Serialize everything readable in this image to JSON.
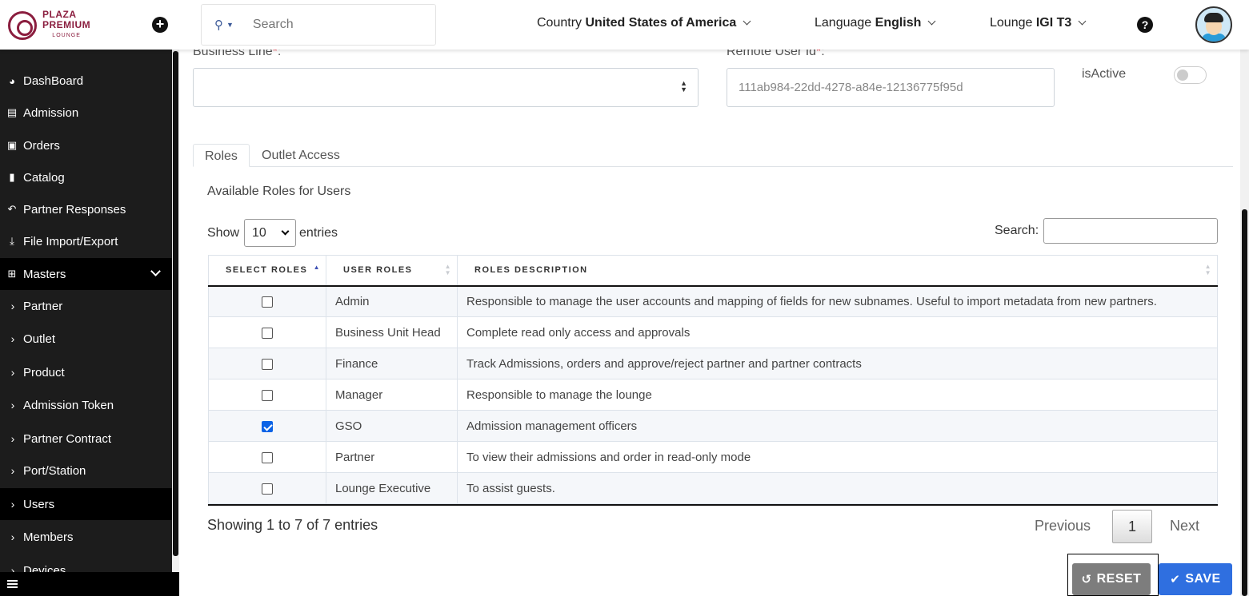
{
  "header": {
    "logo_line1": "PLAZA",
    "logo_line2": "PREMIUM",
    "logo_line3": "LOUNGE",
    "search_placeholder": "Search",
    "country_label": "Country",
    "country_value": "United States of America",
    "language_label": "Language",
    "language_value": "English",
    "lounge_label": "Lounge",
    "lounge_value": "IGI T3",
    "help_glyph": "?"
  },
  "sidebar": {
    "items": [
      {
        "label": "DashBoard",
        "icon": "dashboard-icon",
        "glyph": "◕"
      },
      {
        "label": "Admission",
        "icon": "id-card-icon",
        "glyph": "▤"
      },
      {
        "label": "Orders",
        "icon": "cart-icon",
        "glyph": "🛒"
      },
      {
        "label": "Catalog",
        "icon": "file-icon",
        "glyph": "▮"
      },
      {
        "label": "Partner Responses",
        "icon": "reply-icon",
        "glyph": "↶"
      },
      {
        "label": "File Import/Export",
        "icon": "download-icon",
        "glyph": "⤓"
      },
      {
        "label": "Masters",
        "icon": "sitemap-icon",
        "glyph": "⊞"
      }
    ],
    "sub_items": [
      {
        "label": "Partner"
      },
      {
        "label": "Outlet"
      },
      {
        "label": "Product"
      },
      {
        "label": "Admission Token"
      },
      {
        "label": "Partner Contract"
      },
      {
        "label": "Port/Station"
      },
      {
        "label": "Users",
        "active": true
      },
      {
        "label": "Members"
      },
      {
        "label": "Devices"
      }
    ]
  },
  "form": {
    "business_line_label": "Business Line",
    "required_mark": "*",
    "label_suffix": ":",
    "business_line_value": "",
    "remote_user_id_label": "Remote User Id",
    "remote_user_id_value": "111ab984-22dd-4278-a84e-12136775f95d",
    "is_active_label": "isActive",
    "is_active": false
  },
  "tabs": [
    {
      "label": "Roles",
      "active": true
    },
    {
      "label": "Outlet Access",
      "active": false
    }
  ],
  "roles": {
    "title": "Available Roles for Users",
    "show_label": "Show",
    "entries_label": "entries",
    "page_size": "10",
    "search_label": "Search:",
    "search_value": "",
    "columns": [
      "SELECT ROLES",
      "USER ROLES",
      "ROLES DESCRIPTION"
    ],
    "rows": [
      {
        "checked": false,
        "role": "Admin",
        "description": "Responsible to manage the user accounts and mapping of fields for new subnames. Useful to import metadata from new partners."
      },
      {
        "checked": false,
        "role": "Business Unit Head",
        "description": "Complete read only access and approvals"
      },
      {
        "checked": false,
        "role": "Finance",
        "description": "Track Admissions, orders and approve/reject partner and partner contracts"
      },
      {
        "checked": false,
        "role": "Manager",
        "description": "Responsible to manage the lounge"
      },
      {
        "checked": true,
        "role": "GSO",
        "description": "Admission management officers"
      },
      {
        "checked": false,
        "role": "Partner",
        "description": "To view their admissions and order in read-only mode"
      },
      {
        "checked": false,
        "role": "Lounge Executive",
        "description": "To assist guests."
      }
    ],
    "info": "Showing 1 to 7 of 7 entries",
    "pager": {
      "previous": "Previous",
      "page": "1",
      "next": "Next"
    }
  },
  "actions": {
    "reset_label": "RESET",
    "save_label": "SAVE"
  },
  "colors": {
    "brand": "#8b1e3f",
    "sidebar_bg": "#1c1c1c",
    "save_button": "#2f6fe0",
    "reset_button": "#7d7d7d",
    "checkbox_checked": "#0b63e6"
  }
}
